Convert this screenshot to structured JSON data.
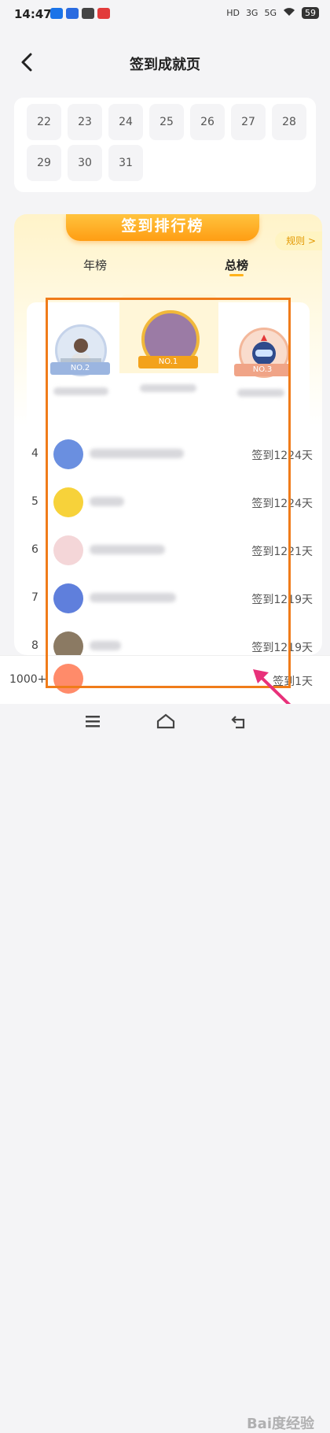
{
  "status_bar": {
    "time": "14:47",
    "battery": "59",
    "signal_labels": [
      "HD",
      "3G",
      "5G"
    ]
  },
  "header": {
    "title": "签到成就页"
  },
  "calendar": {
    "rows": [
      [
        "22",
        "23",
        "24",
        "25",
        "26",
        "27",
        "28"
      ],
      [
        "29",
        "30",
        "31"
      ]
    ]
  },
  "ranking": {
    "banner": "签到排行榜",
    "rules_label": "规则 >",
    "tabs": [
      {
        "label": "年榜",
        "active": false
      },
      {
        "label": "总榜",
        "active": true
      }
    ],
    "podium": [
      {
        "rank_label": "NO.2",
        "rank": 2
      },
      {
        "rank_label": "NO.1",
        "rank": 1
      },
      {
        "rank_label": "NO.3",
        "rank": 3
      }
    ],
    "list": [
      {
        "rank": "4",
        "days": "签到1224天"
      },
      {
        "rank": "5",
        "days": "签到1224天"
      },
      {
        "rank": "6",
        "days": "签到1221天"
      },
      {
        "rank": "7",
        "days": "签到1219天"
      },
      {
        "rank": "8",
        "days": "签到1219天"
      }
    ],
    "my_rank": {
      "rank": "1000+",
      "days": "签到1天"
    }
  },
  "watermark": "Bai度经验",
  "colors": {
    "accent": "#ffb21a",
    "highlight": "#f07c1a",
    "arrow": "#e8317a"
  }
}
